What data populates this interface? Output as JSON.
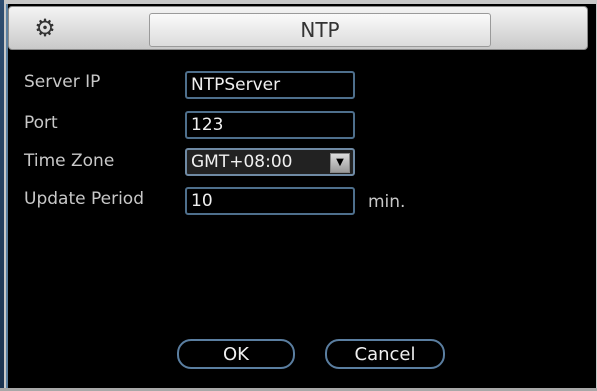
{
  "dialog": {
    "title": "NTP"
  },
  "form": {
    "server_ip_label": "Server IP",
    "server_ip_value": "NTPServer",
    "port_label": "Port",
    "port_value": "123",
    "time_zone_label": "Time Zone",
    "time_zone_value": "GMT+08:00",
    "update_period_label": "Update Period",
    "update_period_value": "10",
    "update_period_unit": "min."
  },
  "buttons": {
    "ok_label": "OK",
    "cancel_label": "Cancel"
  },
  "icons": {
    "title_icon": "gear-icon",
    "dropdown_icon": "chevron-down-icon"
  },
  "colors": {
    "field_border": "#4e6f8c",
    "background": "#000000",
    "label_text": "#c8c8c8",
    "value_text": "#f0f0f0"
  }
}
